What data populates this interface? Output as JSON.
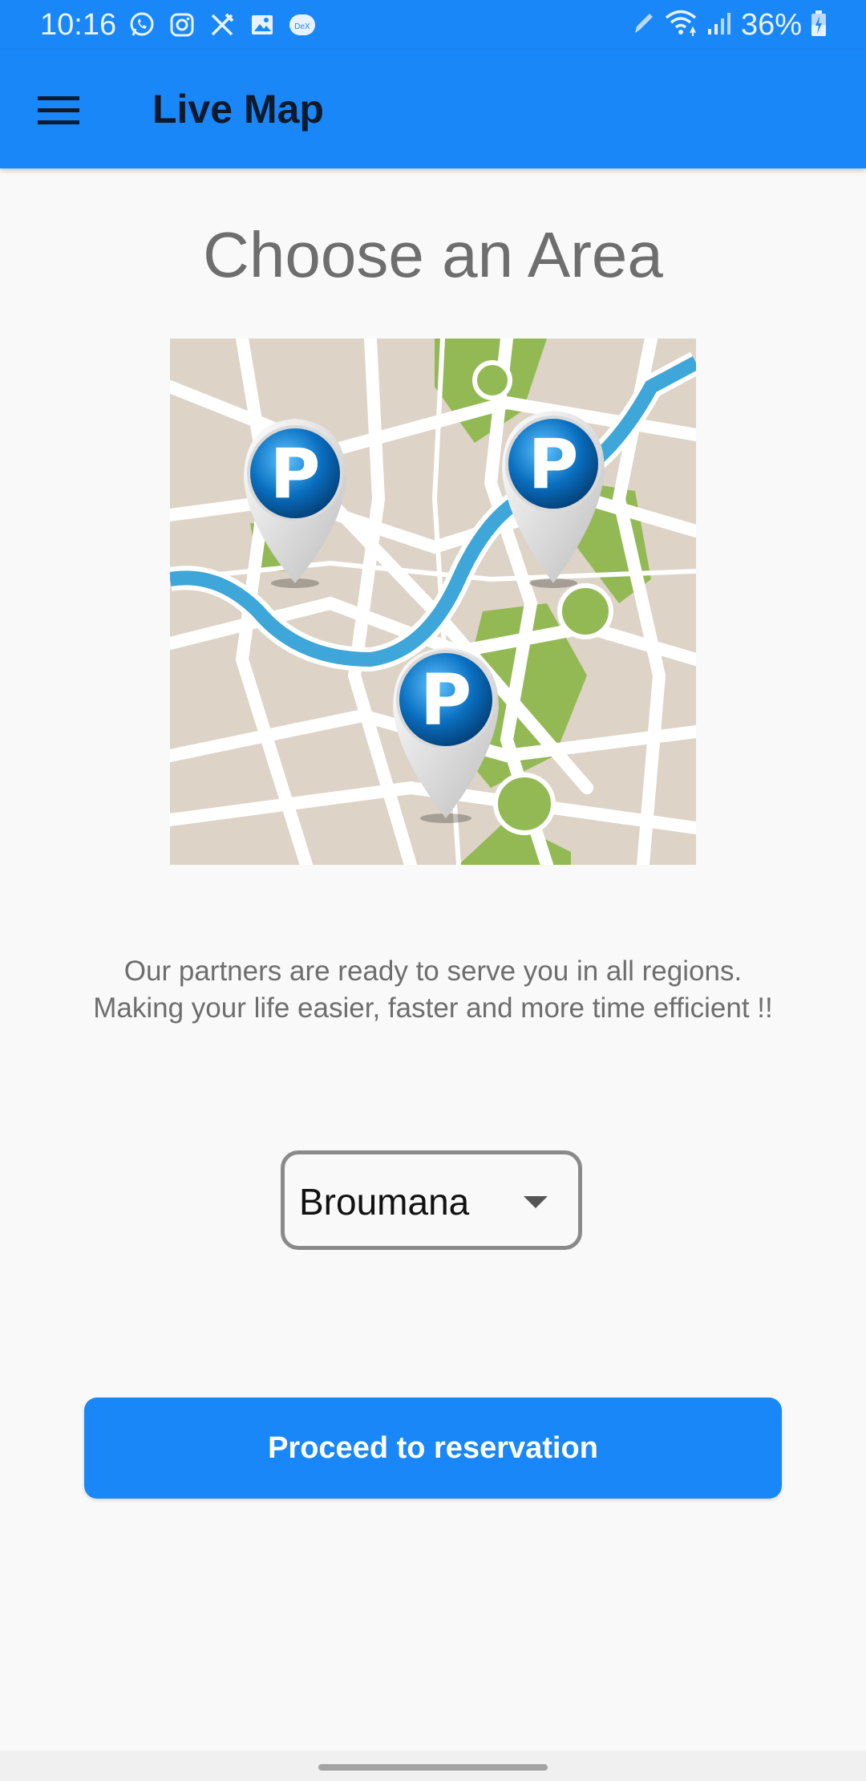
{
  "status_bar": {
    "time": "10:16",
    "battery": "36%",
    "notification_icons": [
      "whatsapp-icon",
      "instagram-icon",
      "no-tools-icon",
      "image-icon",
      "dex-icon"
    ],
    "dex_label": "DeX",
    "system_icons": [
      "pen-icon",
      "wifi-icon",
      "signal-icon",
      "battery-charging-icon"
    ]
  },
  "app_bar": {
    "title": "Live Map",
    "background": "#1a87f8",
    "menu_icon": "hamburger-menu-icon"
  },
  "main": {
    "heading": "Choose an Area",
    "map_icons": [
      "parking-p-icon",
      "parking-p-icon",
      "parking-p-icon"
    ],
    "description": "Our partners are ready to serve you in all regions. Making your life easier, faster and more time efficient !!",
    "area_select": {
      "value": "Broumana",
      "icon": "dropdown-arrow-icon"
    },
    "proceed_label": "Proceed to reservation"
  },
  "colors": {
    "accent": "#1a87f8",
    "text_muted": "#6e6e6e",
    "map_water": "#3ea6d8",
    "map_park": "#8fb651",
    "map_land": "#dcd2c4"
  }
}
